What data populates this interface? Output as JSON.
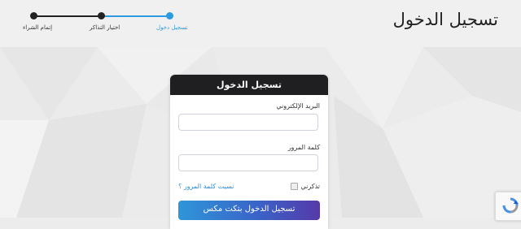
{
  "header": {
    "title": "تسجيل الدخول",
    "steps": [
      {
        "label": "تسجيل دخول",
        "state": "active",
        "color": "#2d9be0"
      },
      {
        "label": "اختيار التذاكر",
        "state": "pending",
        "color": "#222222"
      },
      {
        "label": "إتمام الشراء",
        "state": "pending",
        "color": "#222222"
      }
    ]
  },
  "login_card": {
    "title": "تسجيل الدخول",
    "email_label": "البريد الإلكتروني",
    "email_value": "",
    "password_label": "كلمة المرور",
    "password_value": "",
    "remember_label": "تذكرني",
    "forgot_link": "نسيت كلمة المرور ؟",
    "sso_button": "تسجيل الدخول بتكت مكس"
  },
  "colors": {
    "accent": "#2d9be0",
    "card_header": "#1f1f22",
    "button_gradient_start": "#2f96d8",
    "button_gradient_end": "#553aa8"
  },
  "icons": [
    "recaptcha-icon",
    "checkbox-icon"
  ]
}
